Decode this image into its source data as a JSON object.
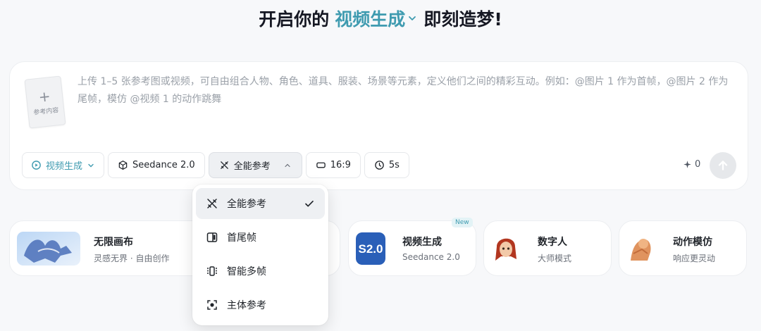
{
  "headline": {
    "prefix": "开启你的",
    "mode": "视频生成",
    "suffix": "即刻造梦!"
  },
  "composer": {
    "reference_card": {
      "plus": "+",
      "label": "参考内容"
    },
    "prompt_placeholder": "上传 1–5 张参考图或视频，可自由组合人物、角色、道具、服装、场景等元素，定义他们之间的精彩互动。例如：@图片 1 作为首帧，@图片 2 作为尾帧，模仿 @视频 1 的动作跳舞",
    "toolbar": {
      "mode": "视频生成",
      "model": "Seedance 2.0",
      "reference": "全能参考",
      "ratio": "16:9",
      "duration": "5s"
    },
    "credits": "0"
  },
  "reference_menu": {
    "items": [
      {
        "label": "全能参考",
        "icon": "all-reference-icon",
        "selected": true
      },
      {
        "label": "首尾帧",
        "icon": "first-last-frame-icon",
        "selected": false
      },
      {
        "label": "智能多帧",
        "icon": "multi-frame-icon",
        "selected": false
      },
      {
        "label": "主体参考",
        "icon": "subject-reference-icon",
        "selected": false
      }
    ]
  },
  "feature_cards": [
    {
      "title": "无限画布",
      "subtitle": "灵感无界 · 自由创作",
      "thumb": "pegasus-image"
    },
    {
      "title": "视频生成",
      "subtitle": "Seedance 2.0",
      "badge": "New",
      "thumb": "seedance-logo"
    },
    {
      "title": "数字人",
      "subtitle": "大师模式",
      "thumb": "digital-human-image"
    },
    {
      "title": "动作模仿",
      "subtitle": "响应更灵动",
      "thumb": "motion-image"
    }
  ],
  "colors": {
    "accent": "#3f9bb0",
    "background": "#f7f8fa",
    "card": "#ffffff",
    "selected": "#eef0f3"
  }
}
